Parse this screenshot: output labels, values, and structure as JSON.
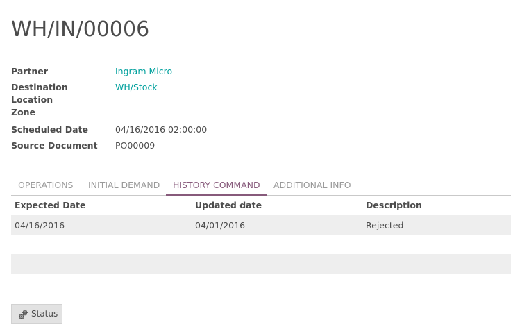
{
  "record": {
    "title": "WH/IN/00006"
  },
  "fields": {
    "partner_label": "Partner",
    "partner_value": "Ingram Micro",
    "destination_label_line1": "Destination Location",
    "destination_label_line2": "Zone",
    "destination_value": "WH/Stock",
    "scheduled_label": "Scheduled Date",
    "scheduled_value": "04/16/2016 02:00:00",
    "source_label": "Source Document",
    "source_value": "PO00009"
  },
  "tabs": [
    {
      "label": "OPERATIONS",
      "active": false
    },
    {
      "label": "INITIAL DEMAND",
      "active": false
    },
    {
      "label": "HISTORY COMMAND",
      "active": true
    },
    {
      "label": "ADDITIONAL INFO",
      "active": false
    }
  ],
  "history_table": {
    "columns": [
      "Expected Date",
      "Updated date",
      "Description"
    ],
    "rows": [
      [
        "04/16/2016",
        "04/01/2016",
        "Rejected"
      ]
    ]
  },
  "actions": {
    "status_label": "Status",
    "status_icon": "gears-icon"
  },
  "colors": {
    "link": "#00a09d",
    "active_tab": "#875a7b",
    "row_bg": "#eeeeee"
  }
}
